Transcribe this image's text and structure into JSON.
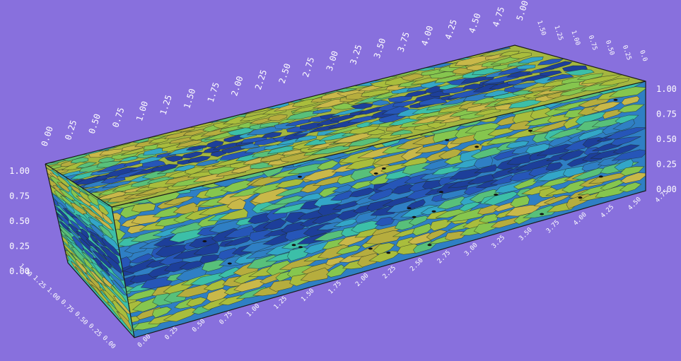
{
  "colors": {
    "background": "#8870dd",
    "tick_text": "#ffffff",
    "grain_palette": [
      "#1d3f9a",
      "#2656b8",
      "#2f7fc4",
      "#33a6c8",
      "#3cbfa8",
      "#58c07a",
      "#86c64e",
      "#a9bd3c",
      "#b6ad3e",
      "#c9b849"
    ]
  },
  "axes": {
    "top_long": {
      "ticks": [
        "0.00",
        "0.25",
        "0.50",
        "0.75",
        "1.00",
        "1.25",
        "1.50",
        "1.75",
        "2.00",
        "2.25",
        "2.50",
        "2.75",
        "3.00",
        "3.25",
        "3.50",
        "3.75",
        "4.00",
        "4.25",
        "4.50",
        "4.75",
        "5.00"
      ]
    },
    "top_short": {
      "ticks": [
        "1.50",
        "1.25",
        "1.00",
        "0.75",
        "0.50",
        "0.25",
        "0.0"
      ]
    },
    "right_vertical": {
      "ticks": [
        "0.00",
        "0.25",
        "0.50",
        "0.75",
        "1.00"
      ]
    },
    "left_vertical": {
      "ticks": [
        "0.00",
        "0.25",
        "0.50",
        "0.75",
        "1.00"
      ]
    },
    "bottom_long": {
      "ticks": [
        "0.00",
        "0.25",
        "0.50",
        "0.75",
        "1.00",
        "1.25",
        "1.50",
        "1.75",
        "2.00",
        "2.25",
        "2.50",
        "2.75",
        "3.00",
        "3.25",
        "3.50",
        "3.75",
        "4.00",
        "4.25",
        "4.50",
        "4.75"
      ]
    },
    "bottom_short": {
      "ticks": [
        "0.00",
        "0.25",
        "0.50",
        "0.75",
        "1.00",
        "1.25",
        "1.50"
      ]
    }
  }
}
